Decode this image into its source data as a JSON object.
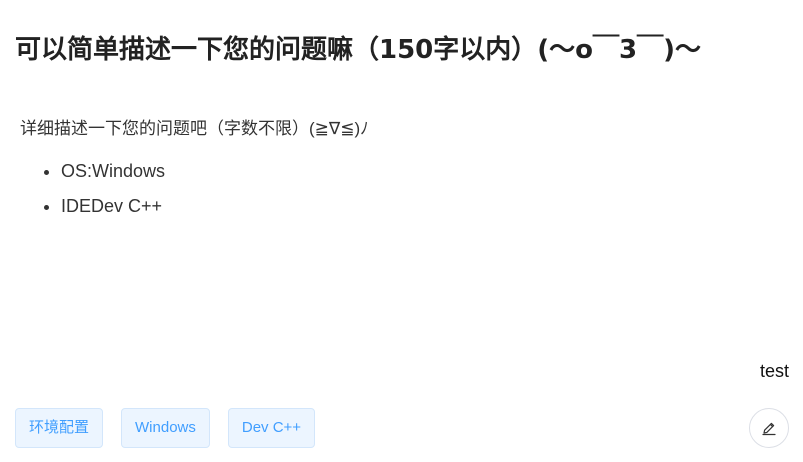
{
  "question": {
    "title": "可以简单描述一下您的问题嘛（150字以内）(～o￣3￣)～",
    "description": "详细描述一下您的问题吧（字数不限）(≧∇≦)ﾉ",
    "environment": [
      "OS:Windows",
      "IDEDev C++"
    ],
    "author": "test"
  },
  "tags": [
    "环境配置",
    "Windows",
    "Dev C++"
  ],
  "actions": {
    "edit_icon": "pencil-icon"
  }
}
